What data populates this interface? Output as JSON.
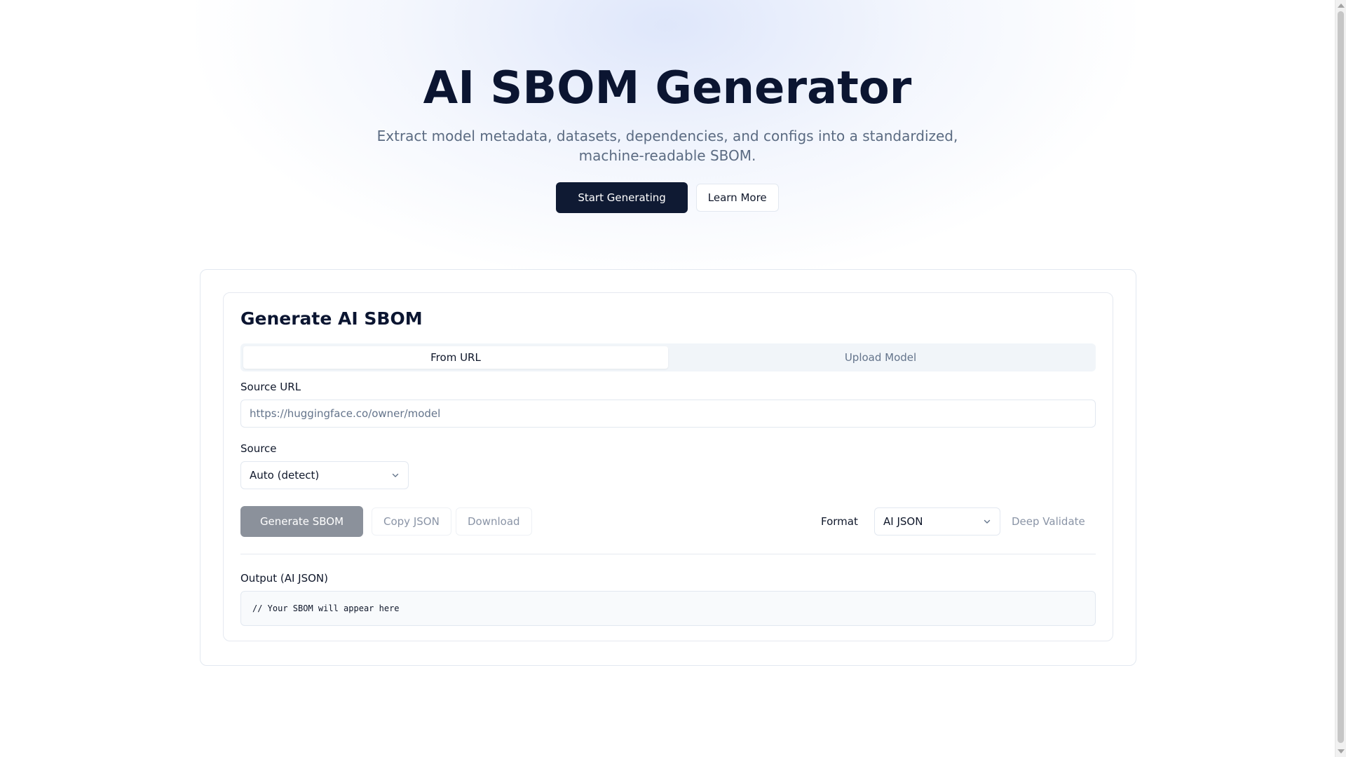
{
  "hero": {
    "title": "AI SBOM Generator",
    "subtitle": "Extract model metadata, datasets, dependencies, and configs into a standardized, machine-readable SBOM.",
    "primary_button": "Start Generating",
    "secondary_button": "Learn More"
  },
  "generator": {
    "title": "Generate AI SBOM",
    "tabs": [
      {
        "label": "From URL",
        "active": true
      },
      {
        "label": "Upload Model",
        "active": false
      }
    ],
    "source_url": {
      "label": "Source URL",
      "placeholder": "https://huggingface.co/owner/model",
      "value": ""
    },
    "source": {
      "label": "Source",
      "selected": "Auto (detect)"
    },
    "actions": {
      "generate": "Generate SBOM",
      "copy": "Copy JSON",
      "download": "Download"
    },
    "format": {
      "label": "Format",
      "selected": "AI JSON"
    },
    "deep_validate": "Deep Validate",
    "output": {
      "label": "Output (AI JSON)",
      "content": "// Your SBOM will appear here"
    }
  },
  "colors": {
    "primary": "#0f1a33",
    "title": "#0b1531",
    "muted": "#64748b",
    "border": "#e2e8f0",
    "disabled_button": "#8b919b"
  },
  "icons": {
    "select_chevron": "chevron-down-icon"
  }
}
